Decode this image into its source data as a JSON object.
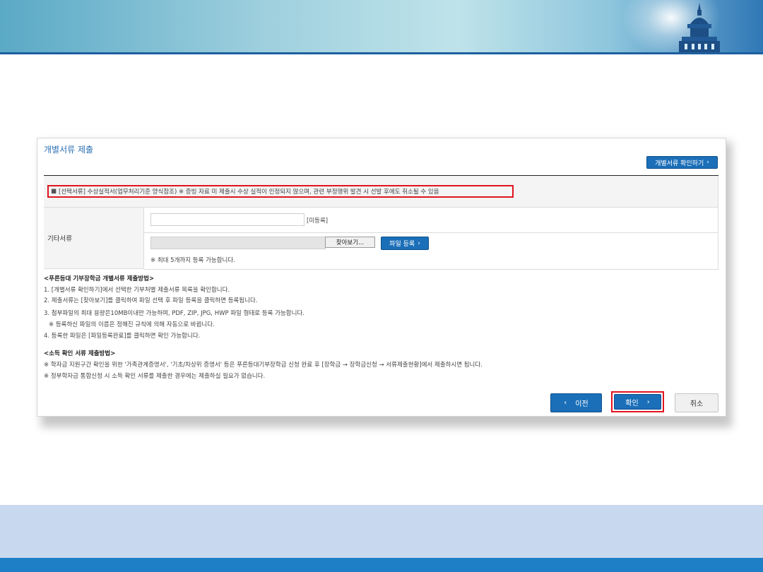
{
  "panel": {
    "title": "개별서류 제출",
    "check_button": "개별서류 확인하기",
    "notice": {
      "bullet": "■",
      "prefix": "[선택서류] 수상실적서(업무처리기준 양식참조) ※ 증빙 자료 미 제출시 수상 실적이 인정되지 않으며, 관련 부정행위 발견 시 선발 후에도 취소될 수 있음"
    },
    "row_label": "기타서류",
    "unregistered": "[미등록]",
    "browse_label": "찾아보기...",
    "upload_label": "파일 등록",
    "max_note": "※ 최대 5개까지 등록 가능합니다."
  },
  "guide": {
    "heading1": "<푸른등대 기부장학금 개별서류 제출방법>",
    "line1": "1. [개별서류 확인하기]에서 선택한 기부처별 제출서류 목록을 확인합니다.",
    "line2": "2. 제출서류는 [찾아보기]를 클릭하여 파일 선택 후 파일 등록을 클릭하면 등록됩니다.",
    "line3": "3. 첨부파일의 최대 용량은10MB이내만 가능하며, PDF, ZIP, JPG, HWP 파일 형태로 등록 가능합니다.",
    "line3b": "※ 등록하신 파일의 이름은 정해진 규칙에 의해 자동으로 바뀝니다.",
    "line4": "4. 등록한 파일은 [파일등록완료]를 클릭하면 확인 가능합니다.",
    "heading2": "<소득 확인 서류 제출방법>",
    "line5": "※ 학자금 지원구간 확인을 위한 '가족관계증명서', '기초/차상위 증명서' 등은 푸른등대기부장학금 신청 완료 후 [장학금 → 장학금신청 → 서류제출현황]에서 제출하시면 됩니다.",
    "line6": "※ 정부학자금 통합신청 시 소득 확인 서류를 제출한 경우에는 제출하실 필요가 없습니다."
  },
  "buttons": {
    "prev": "이전",
    "ok": "확인",
    "cancel": "취소"
  }
}
